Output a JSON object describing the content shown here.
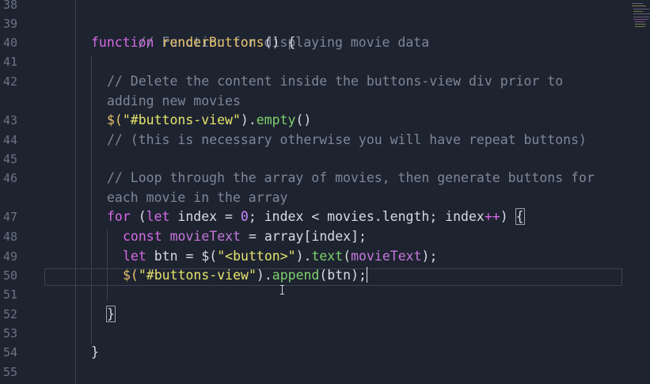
{
  "editor": {
    "line_numbers": [
      "38",
      "39",
      "40",
      "41",
      "42",
      "",
      "43",
      "44",
      "45",
      "46",
      "",
      "47",
      "48",
      "49",
      "50",
      "51",
      "52",
      "53",
      "54",
      "55"
    ],
    "lines": {
      "l39": "// Function for displaying movie data",
      "l40_kw": "function",
      "l40_fn": "renderButtons",
      "l40_rest": "() {",
      "l42a": "// Delete the content inside the buttons-view div prior to",
      "l42b": "adding new movies",
      "l43_a": "$(",
      "l43_str": "\"#buttons-view\"",
      "l43_b": ").",
      "l43_meth": "empty",
      "l43_c": "()",
      "l44": "// (this is necessary otherwise you will have repeat buttons)",
      "l46a": "// Loop through the array of movies, then generate buttons for",
      "l46b": "each movie in the array",
      "l47_kw": "for",
      "l47_a": " (",
      "l47_let": "let",
      "l47_b": " index = ",
      "l47_num": "0",
      "l47_c": "; index < movies.length; index",
      "l47_op": "++",
      "l47_d": ") ",
      "l47_brace": "{",
      "l48_kw": "const",
      "l48_var": "movieText",
      "l48_rest": " = array[index];",
      "l49_kw": "let",
      "l49_a": " btn = $(",
      "l49_str": "\"<button>\"",
      "l49_b": ").",
      "l49_meth": "text",
      "l49_c": "(",
      "l49_var": "movieText",
      "l49_d": ");",
      "l50_a": "$(",
      "l50_str": "\"#buttons-view\"",
      "l50_b": ").",
      "l50_meth": "append",
      "l50_c": "(btn);",
      "l52": "}",
      "l54": "}"
    },
    "colors": {
      "background": "#1e2330",
      "comment": "#7d8799",
      "keyword": "#d66be6",
      "function": "#e5c16a",
      "string": "#e6e46b",
      "method": "#7fd16e"
    }
  }
}
